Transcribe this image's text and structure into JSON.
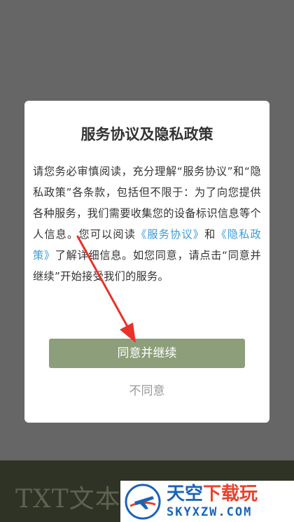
{
  "background": {
    "bottom_text": "TXT文本"
  },
  "dialog": {
    "title": "服务协议及隐私政策",
    "body": {
      "part1": "请您务必审慎阅读，充分理解“服务协议”和“隐私政策”各条款，包括但不限于：为了向您提供各种服务，我们需要收集您的设备标识信息等个人信息。您可以阅读",
      "link_service": "《服务协议》",
      "part2": "和",
      "link_privacy": "《隐私政策》",
      "part3": "了解详细信息。如您同意，请点击“同意并继续”开始接受我们的服务。"
    },
    "agree_label": "同意并继续",
    "disagree_label": "不同意"
  },
  "watermark": {
    "title_part1": "天空",
    "title_part2": "下载玩",
    "subtitle": "SKYXZW.COM"
  },
  "colors": {
    "overlay": "#666666",
    "agree_button": "#8c9e7a",
    "link": "#3a9bd8",
    "arrow": "#e8322a"
  }
}
